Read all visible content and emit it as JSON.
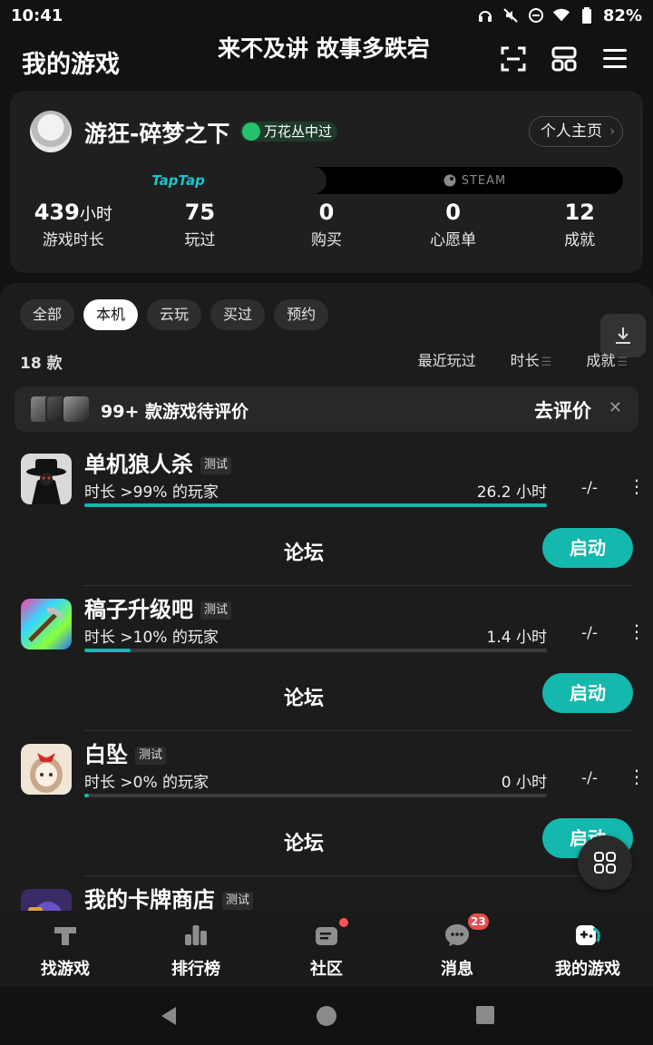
{
  "status_bar": {
    "time": "10:41",
    "battery": "82%"
  },
  "header": {
    "title": "我的游戏",
    "banner_overlay": "来不及讲 故事多跌宕",
    "icons": [
      "scan-icon",
      "layout-icon",
      "menu-icon"
    ]
  },
  "profile": {
    "username": "游狂-碎梦之下",
    "badge": "万花丛中过",
    "home_button": "个人主页",
    "platforms": {
      "active": "TapTap",
      "other": "STEAM"
    },
    "stats": [
      {
        "value": "439",
        "unit": "小时",
        "label": "游戏时长"
      },
      {
        "value": "75",
        "unit": "",
        "label": "玩过"
      },
      {
        "value": "0",
        "unit": "",
        "label": "购买"
      },
      {
        "value": "0",
        "unit": "",
        "label": "心愿单"
      },
      {
        "value": "12",
        "unit": "",
        "label": "成就"
      }
    ]
  },
  "filters": {
    "chips": [
      "全部",
      "本机",
      "云玩",
      "买过",
      "预约"
    ],
    "active_index": 1,
    "count": "18 款",
    "sort": [
      "最近玩过",
      "时长",
      "成就"
    ]
  },
  "review_banner": {
    "text": "99+ 款游戏待评价",
    "action": "去评价"
  },
  "games": [
    {
      "name": "单机狼人杀",
      "tag": "测试",
      "percentile": "时长 >99% 的玩家",
      "hours": "26.2 小时",
      "achievement": "-/-",
      "progress": 1.0,
      "forum": "论坛",
      "launch": "启动"
    },
    {
      "name": "稿子升级吧",
      "tag": "测试",
      "percentile": "时长 >10% 的玩家",
      "hours": "1.4 小时",
      "achievement": "-/-",
      "progress": 0.1,
      "forum": "论坛",
      "launch": "启动"
    },
    {
      "name": "白坠",
      "tag": "测试",
      "percentile": "时长 >0% 的玩家",
      "hours": "0 小时",
      "achievement": "-/-",
      "progress": 0.01,
      "forum": "论坛",
      "launch": "启动"
    },
    {
      "name": "我的卡牌商店",
      "tag": "测试"
    }
  ],
  "bottom_nav": [
    {
      "label": "找游戏",
      "icon": "hammer-icon"
    },
    {
      "label": "排行榜",
      "icon": "ranking-icon"
    },
    {
      "label": "社区",
      "icon": "community-icon"
    },
    {
      "label": "消息",
      "icon": "message-icon",
      "badge": "23"
    },
    {
      "label": "我的游戏",
      "icon": "gamepad-icon"
    }
  ],
  "colors": {
    "accent": "#14b8ad",
    "taptap": "#15c5ce",
    "background": "#121212",
    "card": "#1f1f1f"
  }
}
